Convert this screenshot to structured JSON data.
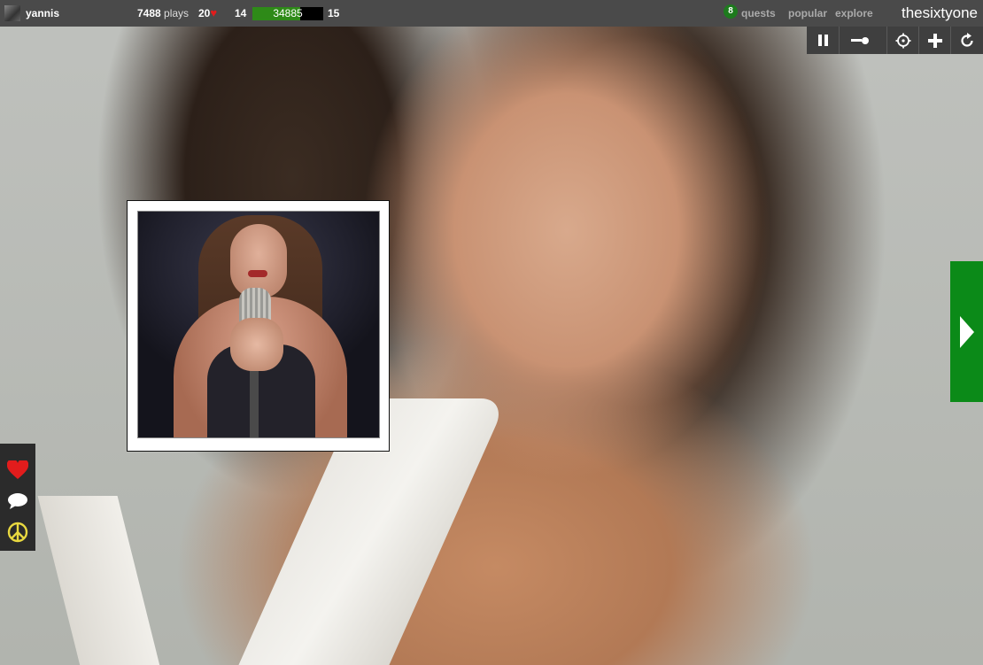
{
  "user": {
    "name": "yannis",
    "plays_count": "7488",
    "plays_label": "plays",
    "hearts_count": "20"
  },
  "progress": {
    "level_current": "14",
    "xp_value": "34885",
    "level_next": "15",
    "fill_fraction": 0.68
  },
  "nav": {
    "quest_badge": "8",
    "quests": "quests",
    "popular": "popular",
    "explore": "explore",
    "brand": "thesixtyone"
  },
  "controls": [
    "pause-icon",
    "volume-icon",
    "target-icon",
    "plus-icon",
    "refresh-icon"
  ],
  "side_actions": [
    "heart-icon",
    "comment-icon",
    "peace-icon"
  ],
  "colors": {
    "topbar": "#4a4a4a",
    "heart": "#e21c1c",
    "accent_green": "#0b8a18",
    "xp_fill": "#2e8a18",
    "peace": "#e8d840"
  }
}
